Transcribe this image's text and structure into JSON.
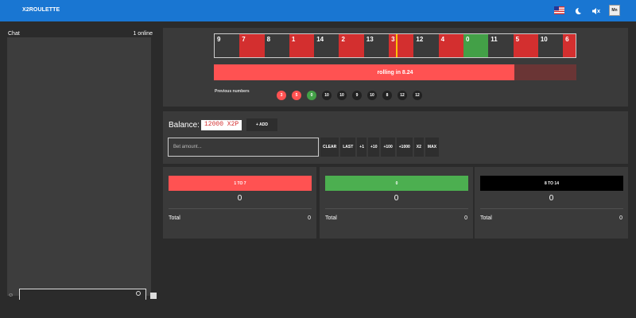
{
  "header": {
    "brand": "X2ROULETTE",
    "avatar_text": "Mn",
    "icons": [
      "us-flag-icon",
      "moon-icon",
      "volume-mute-icon",
      "user-avatar"
    ]
  },
  "chat": {
    "title": "Chat",
    "online": "1 online"
  },
  "roulette": {
    "strip": [
      {
        "n": "9",
        "color": "black"
      },
      {
        "n": "7",
        "color": "red"
      },
      {
        "n": "8",
        "color": "black"
      },
      {
        "n": "1",
        "color": "red"
      },
      {
        "n": "14",
        "color": "black"
      },
      {
        "n": "2",
        "color": "red"
      },
      {
        "n": "13",
        "color": "black"
      },
      {
        "n": "3",
        "color": "red"
      },
      {
        "n": "12",
        "color": "black"
      },
      {
        "n": "4",
        "color": "red"
      },
      {
        "n": "0",
        "color": "green"
      },
      {
        "n": "11",
        "color": "black"
      },
      {
        "n": "5",
        "color": "red"
      },
      {
        "n": "10",
        "color": "black"
      },
      {
        "n": "6",
        "color": "red"
      }
    ],
    "status_text": "rolling in 8.24",
    "progress_fraction": 0.83,
    "previous_label": "Previous numbers",
    "previous": [
      {
        "n": "3",
        "color": "red"
      },
      {
        "n": "5",
        "color": "red"
      },
      {
        "n": "0",
        "color": "green"
      },
      {
        "n": "10",
        "color": "black"
      },
      {
        "n": "10",
        "color": "black"
      },
      {
        "n": "9",
        "color": "black"
      },
      {
        "n": "10",
        "color": "black"
      },
      {
        "n": "8",
        "color": "black"
      },
      {
        "n": "12",
        "color": "black"
      },
      {
        "n": "12",
        "color": "black"
      }
    ]
  },
  "bet": {
    "balance_label": "Balance:",
    "balance_value": "12000 X2P",
    "add_label": "+ ADD",
    "input_placeholder": "Bet amount...",
    "buttons": [
      "CLEAR",
      "LAST",
      "+1",
      "+10",
      "+100",
      "+1000",
      "X2",
      "MAX"
    ]
  },
  "columns": [
    {
      "label": "1 TO 7",
      "color": "red",
      "amount": "0",
      "total_label": "Total",
      "total": "0"
    },
    {
      "label": "0",
      "color": "green",
      "amount": "0",
      "total_label": "Total",
      "total": "0"
    },
    {
      "label": "8 TO 14",
      "color": "black",
      "amount": "0",
      "total_label": "Total",
      "total": "0"
    }
  ],
  "colors": {
    "topbar": "#1976d2",
    "red": "#ff5252",
    "green": "#4caf50",
    "black": "#000000"
  }
}
